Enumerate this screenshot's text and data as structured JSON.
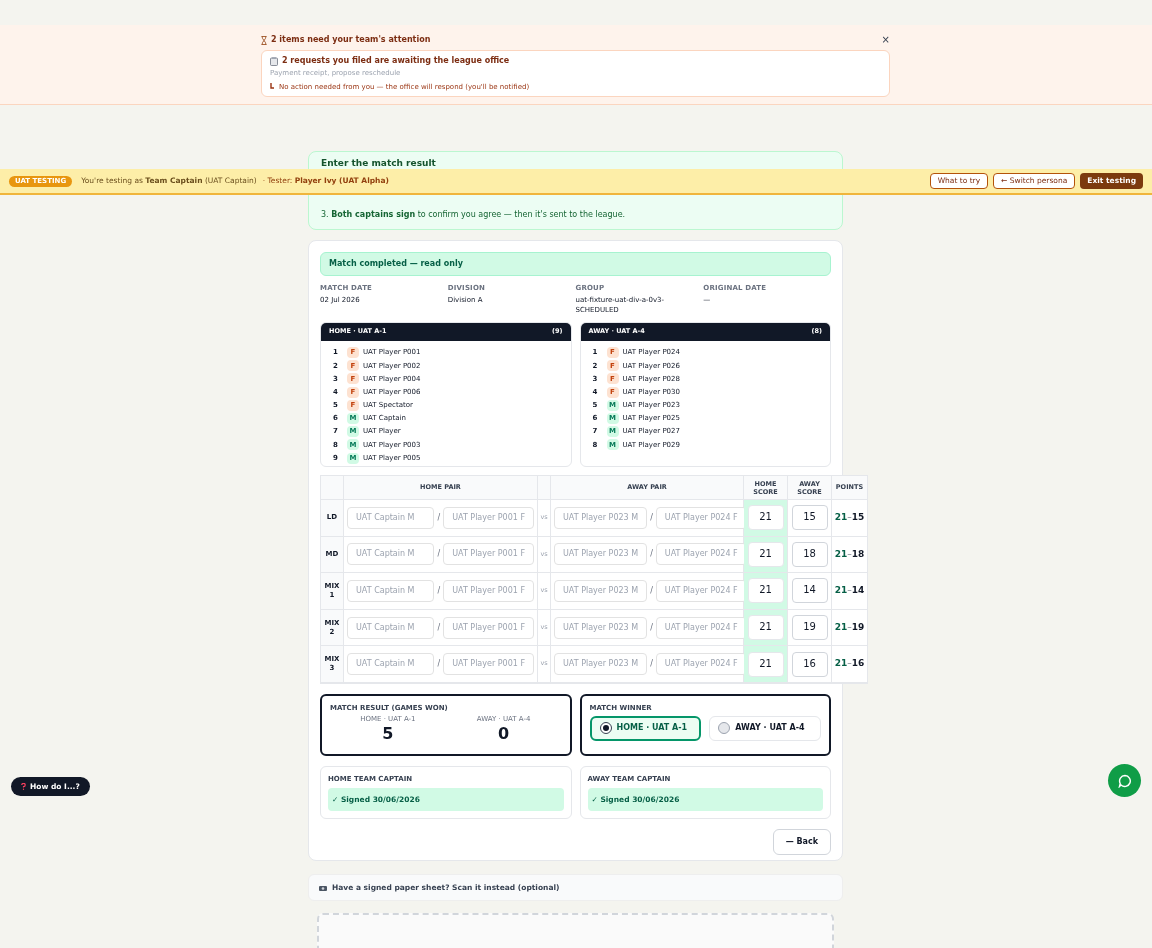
{
  "attention": {
    "title": "2 items need your team's attention",
    "close": "×",
    "request": {
      "title": "2 requests you filed are awaiting the league office",
      "subtitle": "Payment receipt, propose reschedule",
      "note": "No action needed from you — the office will respond (you'll be notified)"
    }
  },
  "uat_banner": {
    "badge": "UAT TESTING",
    "persona": "You're testing as **Team Captain** (UAT Captain)",
    "tester": "· Tester: **Player Ivy (UAT Alpha)**",
    "buttons": [
      {
        "label": "What to try",
        "kind": "outline"
      },
      {
        "label": "← Switch persona",
        "kind": "outline"
      },
      {
        "label": "Exit testing",
        "kind": "primary"
      }
    ]
  },
  "instructions": {
    "title": "Enter the match result",
    "step": "3. **Both captains sign** to confirm you agree — then it's sent to the league."
  },
  "status": "Match completed — read only",
  "meta": [
    {
      "label": "MATCH DATE",
      "value": "02 Jul 2026"
    },
    {
      "label": "DIVISION",
      "value": "Division A"
    },
    {
      "label": "GROUP",
      "value": "uat-fixture-uat-div-a-0v3-SCHEDULED"
    },
    {
      "label": "ORIGINAL DATE",
      "value": "—"
    }
  ],
  "teams": [
    {
      "title": "HOME · UAT A-1",
      "count": "(9)",
      "players": [
        {
          "number": "1",
          "badge": "F",
          "kind": "female",
          "name": "UAT Player P001"
        },
        {
          "number": "2",
          "badge": "F",
          "kind": "female",
          "name": "UAT Player P002"
        },
        {
          "number": "3",
          "badge": "F",
          "kind": "female",
          "name": "UAT Player P004"
        },
        {
          "number": "4",
          "badge": "F",
          "kind": "female",
          "name": "UAT Player P006"
        },
        {
          "number": "5",
          "badge": "F",
          "kind": "female",
          "name": "UAT Spectator"
        },
        {
          "number": "6",
          "badge": "M",
          "kind": "male",
          "name": "UAT Captain"
        },
        {
          "number": "7",
          "badge": "M",
          "kind": "male",
          "name": "UAT Player"
        },
        {
          "number": "8",
          "badge": "M",
          "kind": "male",
          "name": "UAT Player P003"
        },
        {
          "number": "9",
          "badge": "M",
          "kind": "male",
          "name": "UAT Player P005"
        }
      ]
    },
    {
      "title": "AWAY · UAT A-4",
      "count": "(8)",
      "players": [
        {
          "number": "1",
          "badge": "F",
          "kind": "female",
          "name": "UAT Player P024"
        },
        {
          "number": "2",
          "badge": "F",
          "kind": "female",
          "name": "UAT Player P026"
        },
        {
          "number": "3",
          "badge": "F",
          "kind": "female",
          "name": "UAT Player P028"
        },
        {
          "number": "4",
          "badge": "F",
          "kind": "female",
          "name": "UAT Player P030"
        },
        {
          "number": "5",
          "badge": "M",
          "kind": "male",
          "name": "UAT Player P023"
        },
        {
          "number": "6",
          "badge": "M",
          "kind": "male",
          "name": "UAT Player P025"
        },
        {
          "number": "7",
          "badge": "M",
          "kind": "male",
          "name": "UAT Player P027"
        },
        {
          "number": "8",
          "badge": "M",
          "kind": "male",
          "name": "UAT Player P029"
        }
      ]
    }
  ],
  "games_table": {
    "columns": {
      "home_pair": "HOME PAIR",
      "away_pair": "AWAY PAIR",
      "home_score": "HOME SCORE",
      "away_score": "AWAY SCORE",
      "points": "POINTS"
    },
    "rows": [
      {
        "label": "LD",
        "vs": "vs",
        "home": [
          "UAT Captain M",
          "UAT Player P001 F"
        ],
        "away": [
          "UAT Player P023 M",
          "UAT Player P024 F"
        ],
        "home_score": "21",
        "away_score": "15",
        "points_home": "21",
        "points_sep": "–",
        "points_away": "15"
      },
      {
        "label": "MD",
        "vs": "vs",
        "home": [
          "UAT Captain M",
          "UAT Player P001 F"
        ],
        "away": [
          "UAT Player P023 M",
          "UAT Player P024 F"
        ],
        "home_score": "21",
        "away_score": "18",
        "points_home": "21",
        "points_sep": "–",
        "points_away": "18"
      },
      {
        "label": "MIX 1",
        "vs": "vs",
        "home": [
          "UAT Captain M",
          "UAT Player P001 F"
        ],
        "away": [
          "UAT Player P023 M",
          "UAT Player P024 F"
        ],
        "home_score": "21",
        "away_score": "14",
        "points_home": "21",
        "points_sep": "–",
        "points_away": "14"
      },
      {
        "label": "MIX 2",
        "vs": "vs",
        "home": [
          "UAT Captain M",
          "UAT Player P001 F"
        ],
        "away": [
          "UAT Player P023 M",
          "UAT Player P024 F"
        ],
        "home_score": "21",
        "away_score": "19",
        "points_home": "21",
        "points_sep": "–",
        "points_away": "19"
      },
      {
        "label": "MIX 3",
        "vs": "vs",
        "home": [
          "UAT Captain M",
          "UAT Player P001 F"
        ],
        "away": [
          "UAT Player P023 M",
          "UAT Player P024 F"
        ],
        "home_score": "21",
        "away_score": "16",
        "points_home": "21",
        "points_sep": "–",
        "points_away": "16"
      }
    ],
    "pair_separator": "/"
  },
  "result": {
    "title": "MATCH RESULT (GAMES WON)",
    "home_label": "HOME · UAT A-1",
    "home_value": "5",
    "away_label": "AWAY · UAT A-4",
    "away_value": "0"
  },
  "winner": {
    "title": "MATCH WINNER",
    "options": [
      {
        "label": "HOME · UAT A-1",
        "selected": true
      },
      {
        "label": "AWAY · UAT A-4",
        "selected": false
      }
    ]
  },
  "signatures": [
    {
      "title": "HOME TEAM CAPTAIN",
      "status": "✓ Signed 30/06/2026"
    },
    {
      "title": "AWAY TEAM CAPTAIN",
      "status": "✓ Signed 30/06/2026"
    }
  ],
  "back_button": "— Back",
  "scan": {
    "text": "Have a signed paper sheet? Scan it instead (optional)"
  },
  "help_button": "How do I...?"
}
